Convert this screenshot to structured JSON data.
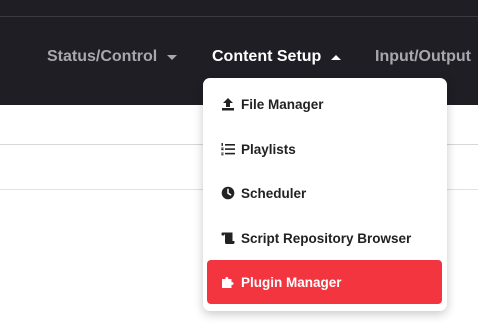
{
  "colors": {
    "navbar_bg": "#1f1e25",
    "nav_inactive": "#a7a7ae",
    "nav_active": "#ffffff",
    "menu_active_bg": "#f3353f",
    "menu_text": "#222222"
  },
  "navbar": {
    "items": [
      {
        "label": "Status/Control",
        "caret": "down",
        "expanded": false
      },
      {
        "label": "Content Setup",
        "caret": "up",
        "expanded": true
      },
      {
        "label": "Input/Output",
        "caret": "none",
        "expanded": false
      }
    ]
  },
  "dropdown": {
    "items": [
      {
        "label": "File Manager",
        "icon": "upload-icon",
        "active": false
      },
      {
        "label": "Playlists",
        "icon": "list-ol-icon",
        "active": false
      },
      {
        "label": "Scheduler",
        "icon": "clock-icon",
        "active": false
      },
      {
        "label": "Script Repository Browser",
        "icon": "scroll-icon",
        "active": false
      },
      {
        "label": "Plugin Manager",
        "icon": "puzzle-piece-icon",
        "active": true
      }
    ]
  }
}
